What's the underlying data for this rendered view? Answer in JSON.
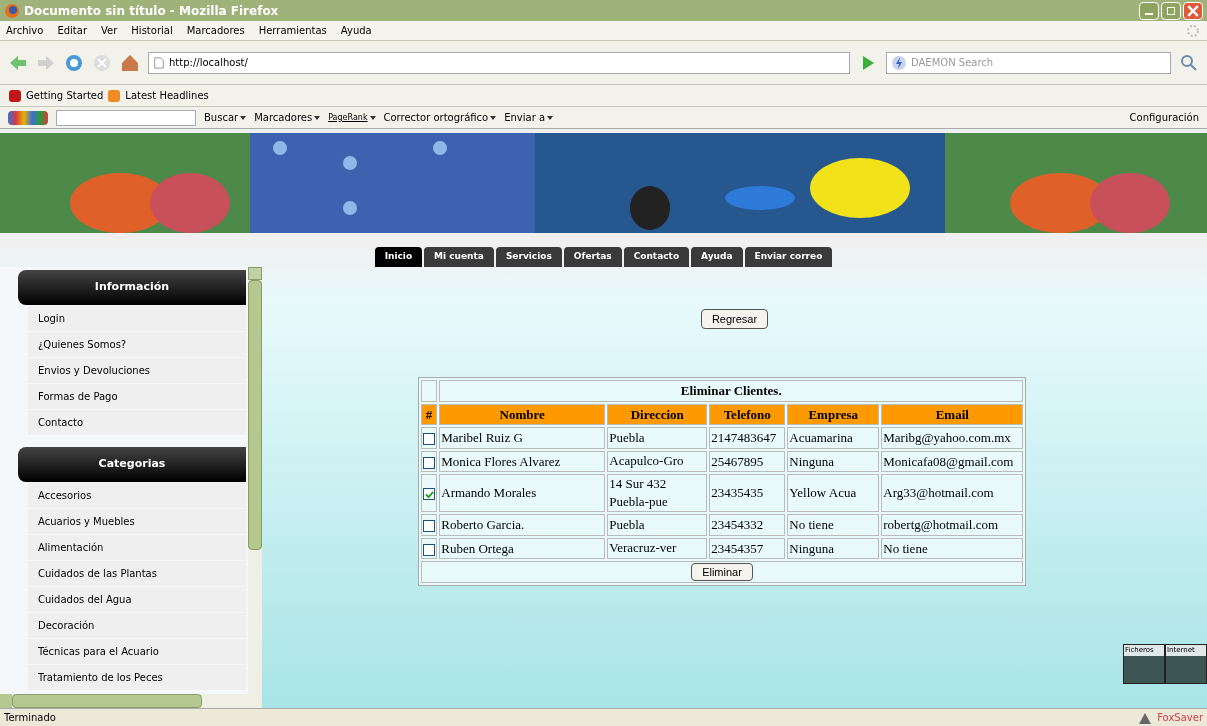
{
  "window": {
    "title": "Documento sin título - Mozilla Firefox"
  },
  "menu": [
    "Archivo",
    "Editar",
    "Ver",
    "Historial",
    "Marcadores",
    "Herramientas",
    "Ayuda"
  ],
  "address": {
    "value": "http://localhost/"
  },
  "search": {
    "placeholder": "DAEMON Search"
  },
  "bookmarks": [
    "Getting Started",
    "Latest Headlines"
  ],
  "google_toolbar": {
    "items": [
      "Buscar",
      "Marcadores",
      "PageRank",
      "Corrector ortográfico",
      "Enviar a"
    ],
    "settings": "Configuración"
  },
  "banner": {
    "kind": "picture"
  },
  "tabs": [
    {
      "label": "Inicio",
      "selected": true
    },
    {
      "label": "Mi cuenta",
      "selected": false
    },
    {
      "label": "Servicios",
      "selected": false
    },
    {
      "label": "Ofertas",
      "selected": false
    },
    {
      "label": "Contacto",
      "selected": false
    },
    {
      "label": "Ayuda",
      "selected": false
    },
    {
      "label": "Enviar correo",
      "selected": false
    }
  ],
  "sidebar": [
    {
      "title": "Información",
      "items": [
        "Login",
        "¿Quienes Somos?",
        "Envios y Devoluciones",
        "Formas de Pago",
        "Contacto"
      ]
    },
    {
      "title": "Categorias",
      "items": [
        "Accesorios",
        "Acuarios y Muebles",
        "Alimentación",
        "Cuidados de las Plantas",
        "Cuidados del Agua",
        "Decoración",
        "Técnicas para el Acuario",
        "Tratamiento de los Peces"
      ]
    }
  ],
  "back_button": "Regresar",
  "table": {
    "title": "Eliminar Clientes.",
    "check_column_header": "#",
    "columns": [
      "Nombre",
      "Direccion",
      "Telefono",
      "Empresa",
      "Email"
    ],
    "rows": [
      {
        "checked": false,
        "cells": [
          "Maribel Ruiz G",
          "Puebla",
          "2147483647",
          "Acuamarina",
          "Maribg@yahoo.com.mx"
        ]
      },
      {
        "checked": false,
        "cells": [
          "Monica Flores Alvarez",
          "Acapulco-Gro",
          "25467895",
          "Ninguna",
          "Monicafa08@gmail.com"
        ]
      },
      {
        "checked": true,
        "cells": [
          "Armando Morales",
          "14 Sur 432 Puebla-pue",
          "23435435",
          "Yellow Acua",
          "Arg33@hotmail.com"
        ]
      },
      {
        "checked": false,
        "cells": [
          "Roberto Garcia.",
          "Puebla",
          "23454332",
          "No tiene",
          "robertg@hotmail.com"
        ]
      },
      {
        "checked": false,
        "cells": [
          "Ruben Ortega",
          "Veracruz-ver",
          "23454357",
          "Ninguna",
          "No tiene"
        ]
      }
    ],
    "delete_button": "Eliminar"
  },
  "foxsaver_panel": [
    "Ficheros",
    "Internet"
  ],
  "status_bar": {
    "text": "Terminado",
    "addon": "FoxSaver"
  }
}
